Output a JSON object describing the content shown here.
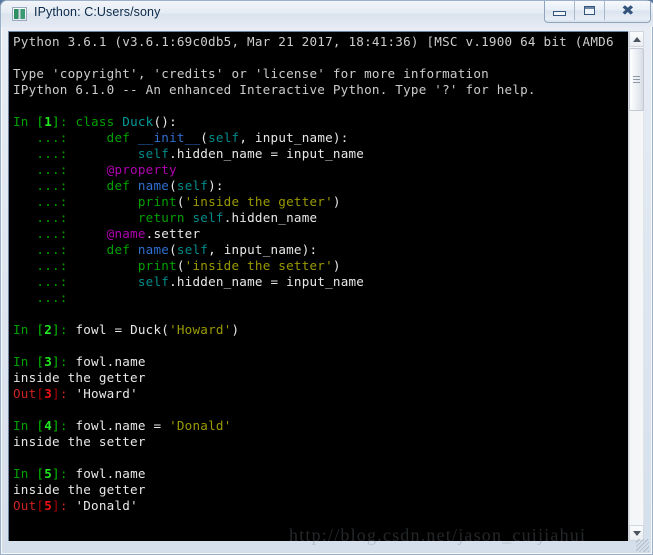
{
  "window": {
    "title": "IPython: C:Users/sony",
    "icon": "ipython-app-icon",
    "buttons": {
      "minimize": "minimize-button",
      "maximize": "maximize-button",
      "close": "close-button"
    }
  },
  "colors": {
    "background": "#000000",
    "default_text": "#cccccc",
    "in_prompt": "#00a000",
    "in_number": "#22e822",
    "out_prompt": "#cc2222",
    "out_number": "#ee1111",
    "keyword": "#00a000",
    "class_name": "#009a9a",
    "function_name": "#2f6fd0",
    "self_keyword": "#008b8b",
    "decorator": "#b000b0",
    "string": "#9a9a00",
    "titlebar_text": "#0b2a49"
  },
  "scrollbar": {
    "up_arrow": "scroll-up-arrow",
    "down_arrow": "scroll-down-arrow",
    "thumb": "scroll-thumb"
  },
  "watermark": {
    "text": "http://blog.csdn.net/jason_cuijiahui"
  },
  "terminal": {
    "lines": [
      {
        "id": "banner-1",
        "segments": [
          {
            "t": "Python 3.6.1 (v3.6.1:69c0db5, Mar 21 2017, 18:41:36) [MSC v.1900 64 bit (AMD6",
            "c": "c-default"
          }
        ]
      },
      {
        "id": "blank-1",
        "segments": [
          {
            "t": "",
            "c": "c-default"
          }
        ]
      },
      {
        "id": "banner-2",
        "segments": [
          {
            "t": "Type 'copyright', 'credits' or 'license' for more information",
            "c": "c-default"
          }
        ]
      },
      {
        "id": "banner-3",
        "segments": [
          {
            "t": "IPython 6.1.0 -- An enhanced Interactive Python. Type '?' for help.",
            "c": "c-default"
          }
        ]
      },
      {
        "id": "blank-2",
        "segments": [
          {
            "t": "",
            "c": "c-default"
          }
        ]
      },
      {
        "id": "in-1",
        "segments": [
          {
            "t": "In ",
            "c": "c-in"
          },
          {
            "t": "[",
            "c": "c-inbr"
          },
          {
            "t": "1",
            "c": "c-innum"
          },
          {
            "t": "]",
            "c": "c-inbr"
          },
          {
            "t": ": ",
            "c": "c-in"
          },
          {
            "t": "class",
            "c": "c-kw"
          },
          {
            "t": " ",
            "c": "c-default"
          },
          {
            "t": "Duck",
            "c": "c-classname"
          },
          {
            "t": "():",
            "c": "c-white"
          }
        ]
      },
      {
        "id": "cont-1",
        "segments": [
          {
            "t": "   ...: ",
            "c": "c-in"
          },
          {
            "t": "    ",
            "c": "c-default"
          },
          {
            "t": "def",
            "c": "c-kw"
          },
          {
            "t": " ",
            "c": "c-default"
          },
          {
            "t": "__init__",
            "c": "c-func"
          },
          {
            "t": "(",
            "c": "c-white"
          },
          {
            "t": "self",
            "c": "c-self"
          },
          {
            "t": ", input_name):",
            "c": "c-white"
          }
        ]
      },
      {
        "id": "cont-2",
        "segments": [
          {
            "t": "   ...: ",
            "c": "c-in"
          },
          {
            "t": "        ",
            "c": "c-default"
          },
          {
            "t": "self",
            "c": "c-self"
          },
          {
            "t": ".hidden_name = input_name",
            "c": "c-white"
          }
        ]
      },
      {
        "id": "cont-3",
        "segments": [
          {
            "t": "   ...: ",
            "c": "c-in"
          },
          {
            "t": "    ",
            "c": "c-default"
          },
          {
            "t": "@property",
            "c": "c-deco"
          }
        ]
      },
      {
        "id": "cont-4",
        "segments": [
          {
            "t": "   ...: ",
            "c": "c-in"
          },
          {
            "t": "    ",
            "c": "c-default"
          },
          {
            "t": "def",
            "c": "c-kw"
          },
          {
            "t": " ",
            "c": "c-default"
          },
          {
            "t": "name",
            "c": "c-func"
          },
          {
            "t": "(",
            "c": "c-white"
          },
          {
            "t": "self",
            "c": "c-self"
          },
          {
            "t": "):",
            "c": "c-white"
          }
        ]
      },
      {
        "id": "cont-5",
        "segments": [
          {
            "t": "   ...: ",
            "c": "c-in"
          },
          {
            "t": "        ",
            "c": "c-default"
          },
          {
            "t": "print",
            "c": "c-builtin"
          },
          {
            "t": "(",
            "c": "c-white"
          },
          {
            "t": "'inside the getter'",
            "c": "c-string"
          },
          {
            "t": ")",
            "c": "c-white"
          }
        ]
      },
      {
        "id": "cont-6",
        "segments": [
          {
            "t": "   ...: ",
            "c": "c-in"
          },
          {
            "t": "        ",
            "c": "c-default"
          },
          {
            "t": "return",
            "c": "c-kw"
          },
          {
            "t": " ",
            "c": "c-default"
          },
          {
            "t": "self",
            "c": "c-self"
          },
          {
            "t": ".hidden_name",
            "c": "c-white"
          }
        ]
      },
      {
        "id": "cont-7",
        "segments": [
          {
            "t": "   ...: ",
            "c": "c-in"
          },
          {
            "t": "    ",
            "c": "c-default"
          },
          {
            "t": "@name",
            "c": "c-deco"
          },
          {
            "t": ".setter",
            "c": "c-white"
          }
        ]
      },
      {
        "id": "cont-8",
        "segments": [
          {
            "t": "   ...: ",
            "c": "c-in"
          },
          {
            "t": "    ",
            "c": "c-default"
          },
          {
            "t": "def",
            "c": "c-kw"
          },
          {
            "t": " ",
            "c": "c-default"
          },
          {
            "t": "name",
            "c": "c-func"
          },
          {
            "t": "(",
            "c": "c-white"
          },
          {
            "t": "self",
            "c": "c-self"
          },
          {
            "t": ", input_name):",
            "c": "c-white"
          }
        ]
      },
      {
        "id": "cont-9",
        "segments": [
          {
            "t": "   ...: ",
            "c": "c-in"
          },
          {
            "t": "        ",
            "c": "c-default"
          },
          {
            "t": "print",
            "c": "c-builtin"
          },
          {
            "t": "(",
            "c": "c-white"
          },
          {
            "t": "'inside the setter'",
            "c": "c-string"
          },
          {
            "t": ")",
            "c": "c-white"
          }
        ]
      },
      {
        "id": "cont-10",
        "segments": [
          {
            "t": "   ...: ",
            "c": "c-in"
          },
          {
            "t": "        ",
            "c": "c-default"
          },
          {
            "t": "self",
            "c": "c-self"
          },
          {
            "t": ".hidden_name = input_name",
            "c": "c-white"
          }
        ]
      },
      {
        "id": "cont-11",
        "segments": [
          {
            "t": "   ...: ",
            "c": "c-in"
          }
        ]
      },
      {
        "id": "blank-3",
        "segments": [
          {
            "t": "",
            "c": "c-default"
          }
        ]
      },
      {
        "id": "in-2",
        "segments": [
          {
            "t": "In ",
            "c": "c-in"
          },
          {
            "t": "[",
            "c": "c-inbr"
          },
          {
            "t": "2",
            "c": "c-innum"
          },
          {
            "t": "]",
            "c": "c-inbr"
          },
          {
            "t": ": ",
            "c": "c-in"
          },
          {
            "t": "fowl = Duck(",
            "c": "c-white"
          },
          {
            "t": "'Howard'",
            "c": "c-string"
          },
          {
            "t": ")",
            "c": "c-white"
          }
        ]
      },
      {
        "id": "blank-4",
        "segments": [
          {
            "t": "",
            "c": "c-default"
          }
        ]
      },
      {
        "id": "in-3",
        "segments": [
          {
            "t": "In ",
            "c": "c-in"
          },
          {
            "t": "[",
            "c": "c-inbr"
          },
          {
            "t": "3",
            "c": "c-innum"
          },
          {
            "t": "]",
            "c": "c-inbr"
          },
          {
            "t": ": ",
            "c": "c-in"
          },
          {
            "t": "fowl.name",
            "c": "c-white"
          }
        ]
      },
      {
        "id": "stdout-1",
        "segments": [
          {
            "t": "inside the getter",
            "c": "c-white"
          }
        ]
      },
      {
        "id": "out-3",
        "segments": [
          {
            "t": "Out",
            "c": "c-out"
          },
          {
            "t": "[",
            "c": "c-outbr"
          },
          {
            "t": "3",
            "c": "c-outnum"
          },
          {
            "t": "]",
            "c": "c-outbr"
          },
          {
            "t": ": ",
            "c": "c-out"
          },
          {
            "t": "'Howard'",
            "c": "c-white"
          }
        ]
      },
      {
        "id": "blank-5",
        "segments": [
          {
            "t": "",
            "c": "c-default"
          }
        ]
      },
      {
        "id": "in-4",
        "segments": [
          {
            "t": "In ",
            "c": "c-in"
          },
          {
            "t": "[",
            "c": "c-inbr"
          },
          {
            "t": "4",
            "c": "c-innum"
          },
          {
            "t": "]",
            "c": "c-inbr"
          },
          {
            "t": ": ",
            "c": "c-in"
          },
          {
            "t": "fowl.name = ",
            "c": "c-white"
          },
          {
            "t": "'Donald'",
            "c": "c-string"
          }
        ]
      },
      {
        "id": "stdout-2",
        "segments": [
          {
            "t": "inside the setter",
            "c": "c-white"
          }
        ]
      },
      {
        "id": "blank-6",
        "segments": [
          {
            "t": "",
            "c": "c-default"
          }
        ]
      },
      {
        "id": "in-5",
        "segments": [
          {
            "t": "In ",
            "c": "c-in"
          },
          {
            "t": "[",
            "c": "c-inbr"
          },
          {
            "t": "5",
            "c": "c-innum"
          },
          {
            "t": "]",
            "c": "c-inbr"
          },
          {
            "t": ": ",
            "c": "c-in"
          },
          {
            "t": "fowl.name",
            "c": "c-white"
          }
        ]
      },
      {
        "id": "stdout-3",
        "segments": [
          {
            "t": "inside the getter",
            "c": "c-white"
          }
        ]
      },
      {
        "id": "out-5",
        "segments": [
          {
            "t": "Out",
            "c": "c-out"
          },
          {
            "t": "[",
            "c": "c-outbr"
          },
          {
            "t": "5",
            "c": "c-outnum"
          },
          {
            "t": "]",
            "c": "c-outbr"
          },
          {
            "t": ": ",
            "c": "c-out"
          },
          {
            "t": "'Donald'",
            "c": "c-white"
          }
        ]
      }
    ]
  }
}
